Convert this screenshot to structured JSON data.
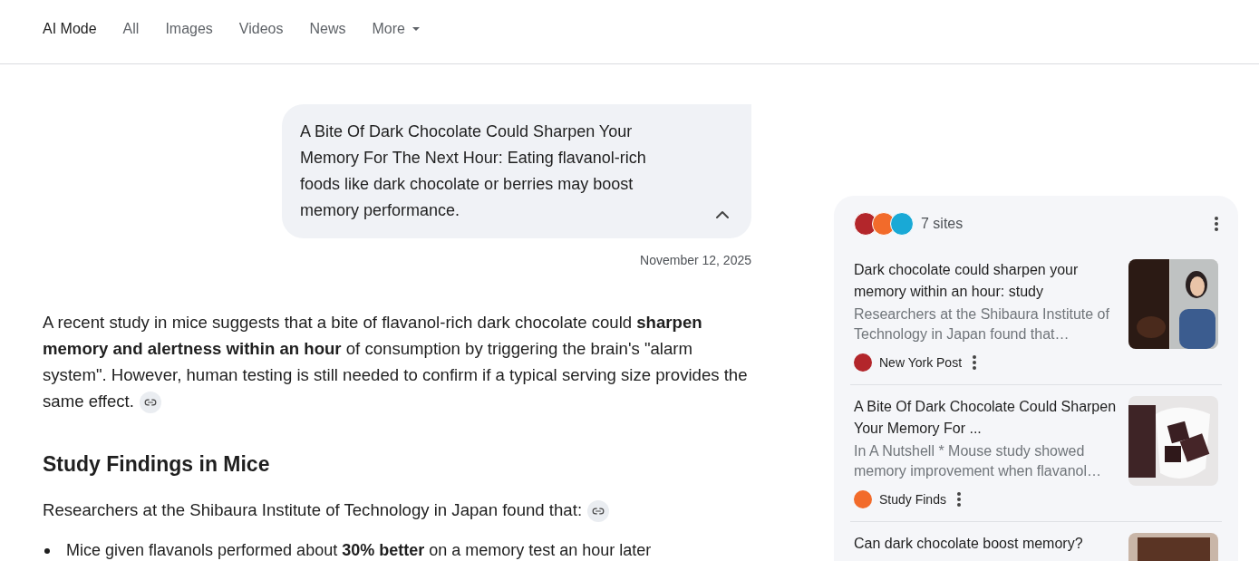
{
  "tabs": [
    {
      "label": "AI Mode",
      "selected": true
    },
    {
      "label": "All",
      "selected": false
    },
    {
      "label": "Images",
      "selected": false
    },
    {
      "label": "Videos",
      "selected": false
    },
    {
      "label": "News",
      "selected": false
    },
    {
      "label": "More",
      "selected": false,
      "kind": "menu"
    }
  ],
  "query": {
    "text": "A Bite Of Dark Chocolate Could Sharpen Your Memory For The Next Hour: Eating flavanol-rich foods like dark chocolate or berries may boost memory performance.",
    "expanded": true,
    "date": "November 12, 2025"
  },
  "answer": [
    {
      "kind": "paragraph",
      "text": "A recent study in mice suggests that a bite of flavanol-rich dark chocolate could **sharpen memory and alertness within an hour** of consumption by triggering the brain's \"alarm system\". However, human testing is still needed to confirm if a typical serving size provides the same effect.",
      "cited": true
    },
    {
      "kind": "heading",
      "text": "Study Findings in Mice"
    },
    {
      "kind": "paragraph",
      "text": "Researchers at the Shibaura Institute of Technology in Japan found that:",
      "cited": true
    },
    {
      "kind": "bullet",
      "text": "Mice given flavanols performed about **30% better** on a memory test an hour later"
    }
  ],
  "sources": {
    "count_label": "7 sites",
    "logos": [
      {
        "color": "#b3262b"
      },
      {
        "color": "#f26b2b"
      },
      {
        "color": "#19a9d6"
      }
    ],
    "items": [
      {
        "title": "Dark chocolate could sharpen your memory within an hour: study",
        "snippet": "Researchers at the Shibaura Institute of Technology in Japan found that…",
        "source": "New York Post",
        "color": "#b3262b"
      },
      {
        "title": "A Bite Of Dark Chocolate Could Sharpen Your Memory For ...",
        "snippet": "In A Nutshell * Mouse study showed memory improvement when flavanol…",
        "source": "Study Finds",
        "color": "#f26b2b"
      },
      {
        "title": "Can dark chocolate boost memory?"
      }
    ]
  }
}
